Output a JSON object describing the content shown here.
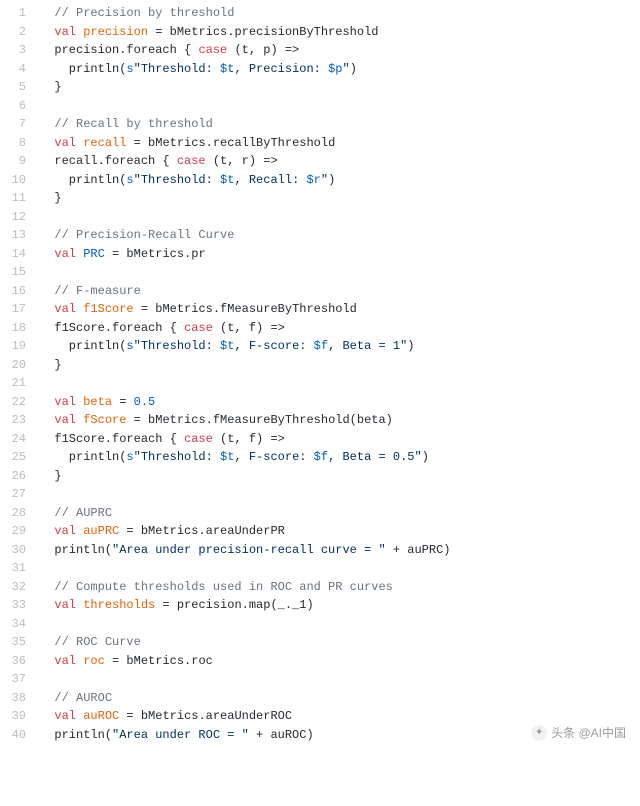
{
  "watermark": "头条 @AI中国",
  "code_lines": [
    {
      "n": 1,
      "tokens": [
        [
          "pl",
          "  "
        ],
        [
          "cm",
          "// Precision by threshold"
        ]
      ]
    },
    {
      "n": 2,
      "tokens": [
        [
          "pl",
          "  "
        ],
        [
          "kw",
          "val"
        ],
        [
          "pl",
          " "
        ],
        [
          "var",
          "precision"
        ],
        [
          "pl",
          " = bMetrics.precisionByThreshold"
        ]
      ]
    },
    {
      "n": 3,
      "tokens": [
        [
          "pl",
          "  precision.foreach { "
        ],
        [
          "kw",
          "case"
        ],
        [
          "pl",
          " (t, p) =>"
        ]
      ]
    },
    {
      "n": 4,
      "tokens": [
        [
          "pl",
          "    println("
        ],
        [
          "dir",
          "s"
        ],
        [
          "str",
          "\"Threshold: "
        ],
        [
          "dir",
          "$t"
        ],
        [
          "str",
          ", Precision: "
        ],
        [
          "dir",
          "$p"
        ],
        [
          "str",
          "\""
        ],
        [
          "pl",
          ")"
        ]
      ]
    },
    {
      "n": 5,
      "tokens": [
        [
          "pl",
          "  }"
        ]
      ]
    },
    {
      "n": 6,
      "tokens": [
        [
          "pl",
          ""
        ]
      ]
    },
    {
      "n": 7,
      "tokens": [
        [
          "pl",
          "  "
        ],
        [
          "cm",
          "// Recall by threshold"
        ]
      ]
    },
    {
      "n": 8,
      "tokens": [
        [
          "pl",
          "  "
        ],
        [
          "kw",
          "val"
        ],
        [
          "pl",
          " "
        ],
        [
          "var",
          "recall"
        ],
        [
          "pl",
          " = bMetrics.recallByThreshold"
        ]
      ]
    },
    {
      "n": 9,
      "tokens": [
        [
          "pl",
          "  recall.foreach { "
        ],
        [
          "kw",
          "case"
        ],
        [
          "pl",
          " (t, r) =>"
        ]
      ]
    },
    {
      "n": 10,
      "tokens": [
        [
          "pl",
          "    println("
        ],
        [
          "dir",
          "s"
        ],
        [
          "str",
          "\"Threshold: "
        ],
        [
          "dir",
          "$t"
        ],
        [
          "str",
          ", Recall: "
        ],
        [
          "dir",
          "$r"
        ],
        [
          "str",
          "\""
        ],
        [
          "pl",
          ")"
        ]
      ]
    },
    {
      "n": 11,
      "tokens": [
        [
          "pl",
          "  }"
        ]
      ]
    },
    {
      "n": 12,
      "tokens": [
        [
          "pl",
          ""
        ]
      ]
    },
    {
      "n": 13,
      "tokens": [
        [
          "pl",
          "  "
        ],
        [
          "cm",
          "// Precision-Recall Curve"
        ]
      ]
    },
    {
      "n": 14,
      "tokens": [
        [
          "pl",
          "  "
        ],
        [
          "kw",
          "val"
        ],
        [
          "pl",
          " "
        ],
        [
          "dir",
          "PRC"
        ],
        [
          "pl",
          " = bMetrics.pr"
        ]
      ]
    },
    {
      "n": 15,
      "tokens": [
        [
          "pl",
          ""
        ]
      ]
    },
    {
      "n": 16,
      "tokens": [
        [
          "pl",
          "  "
        ],
        [
          "cm",
          "// F-measure"
        ]
      ]
    },
    {
      "n": 17,
      "tokens": [
        [
          "pl",
          "  "
        ],
        [
          "kw",
          "val"
        ],
        [
          "pl",
          " "
        ],
        [
          "var",
          "f1Score"
        ],
        [
          "pl",
          " = bMetrics.fMeasureByThreshold"
        ]
      ]
    },
    {
      "n": 18,
      "tokens": [
        [
          "pl",
          "  f1Score.foreach { "
        ],
        [
          "kw",
          "case"
        ],
        [
          "pl",
          " (t, f) =>"
        ]
      ]
    },
    {
      "n": 19,
      "tokens": [
        [
          "pl",
          "    println("
        ],
        [
          "dir",
          "s"
        ],
        [
          "str",
          "\"Threshold: "
        ],
        [
          "dir",
          "$t"
        ],
        [
          "str",
          ", F-score: "
        ],
        [
          "dir",
          "$f"
        ],
        [
          "str",
          ", Beta = 1\""
        ],
        [
          "pl",
          ")"
        ]
      ]
    },
    {
      "n": 20,
      "tokens": [
        [
          "pl",
          "  }"
        ]
      ]
    },
    {
      "n": 21,
      "tokens": [
        [
          "pl",
          ""
        ]
      ]
    },
    {
      "n": 22,
      "tokens": [
        [
          "pl",
          "  "
        ],
        [
          "kw",
          "val"
        ],
        [
          "pl",
          " "
        ],
        [
          "var",
          "beta"
        ],
        [
          "pl",
          " = "
        ],
        [
          "num",
          "0.5"
        ]
      ]
    },
    {
      "n": 23,
      "tokens": [
        [
          "pl",
          "  "
        ],
        [
          "kw",
          "val"
        ],
        [
          "pl",
          " "
        ],
        [
          "var",
          "fScore"
        ],
        [
          "pl",
          " = bMetrics.fMeasureByThreshold(beta)"
        ]
      ]
    },
    {
      "n": 24,
      "tokens": [
        [
          "pl",
          "  f1Score.foreach { "
        ],
        [
          "kw",
          "case"
        ],
        [
          "pl",
          " (t, f) =>"
        ]
      ]
    },
    {
      "n": 25,
      "tokens": [
        [
          "pl",
          "    println("
        ],
        [
          "dir",
          "s"
        ],
        [
          "str",
          "\"Threshold: "
        ],
        [
          "dir",
          "$t"
        ],
        [
          "str",
          ", F-score: "
        ],
        [
          "dir",
          "$f"
        ],
        [
          "str",
          ", Beta = 0.5\""
        ],
        [
          "pl",
          ")"
        ]
      ]
    },
    {
      "n": 26,
      "tokens": [
        [
          "pl",
          "  }"
        ]
      ]
    },
    {
      "n": 27,
      "tokens": [
        [
          "pl",
          ""
        ]
      ]
    },
    {
      "n": 28,
      "tokens": [
        [
          "pl",
          "  "
        ],
        [
          "cm",
          "// AUPRC"
        ]
      ]
    },
    {
      "n": 29,
      "tokens": [
        [
          "pl",
          "  "
        ],
        [
          "kw",
          "val"
        ],
        [
          "pl",
          " "
        ],
        [
          "var",
          "auPRC"
        ],
        [
          "pl",
          " = bMetrics.areaUnderPR"
        ]
      ]
    },
    {
      "n": 30,
      "tokens": [
        [
          "pl",
          "  println("
        ],
        [
          "str",
          "\"Area under precision-recall curve = \""
        ],
        [
          "pl",
          " + auPRC)"
        ]
      ]
    },
    {
      "n": 31,
      "tokens": [
        [
          "pl",
          ""
        ]
      ]
    },
    {
      "n": 32,
      "tokens": [
        [
          "pl",
          "  "
        ],
        [
          "cm",
          "// Compute thresholds used in ROC and PR curves"
        ]
      ]
    },
    {
      "n": 33,
      "tokens": [
        [
          "pl",
          "  "
        ],
        [
          "kw",
          "val"
        ],
        [
          "pl",
          " "
        ],
        [
          "var",
          "thresholds"
        ],
        [
          "pl",
          " = precision.map(_._1)"
        ]
      ]
    },
    {
      "n": 34,
      "tokens": [
        [
          "pl",
          ""
        ]
      ]
    },
    {
      "n": 35,
      "tokens": [
        [
          "pl",
          "  "
        ],
        [
          "cm",
          "// ROC Curve"
        ]
      ]
    },
    {
      "n": 36,
      "tokens": [
        [
          "pl",
          "  "
        ],
        [
          "kw",
          "val"
        ],
        [
          "pl",
          " "
        ],
        [
          "var",
          "roc"
        ],
        [
          "pl",
          " = bMetrics.roc"
        ]
      ]
    },
    {
      "n": 37,
      "tokens": [
        [
          "pl",
          ""
        ]
      ]
    },
    {
      "n": 38,
      "tokens": [
        [
          "pl",
          "  "
        ],
        [
          "cm",
          "// AUROC"
        ]
      ]
    },
    {
      "n": 39,
      "tokens": [
        [
          "pl",
          "  "
        ],
        [
          "kw",
          "val"
        ],
        [
          "pl",
          " "
        ],
        [
          "var",
          "auROC"
        ],
        [
          "pl",
          " = bMetrics.areaUnderROC"
        ]
      ]
    },
    {
      "n": 40,
      "tokens": [
        [
          "pl",
          "  println("
        ],
        [
          "str",
          "\"Area under ROC = \""
        ],
        [
          "pl",
          " + auROC)"
        ]
      ]
    }
  ]
}
